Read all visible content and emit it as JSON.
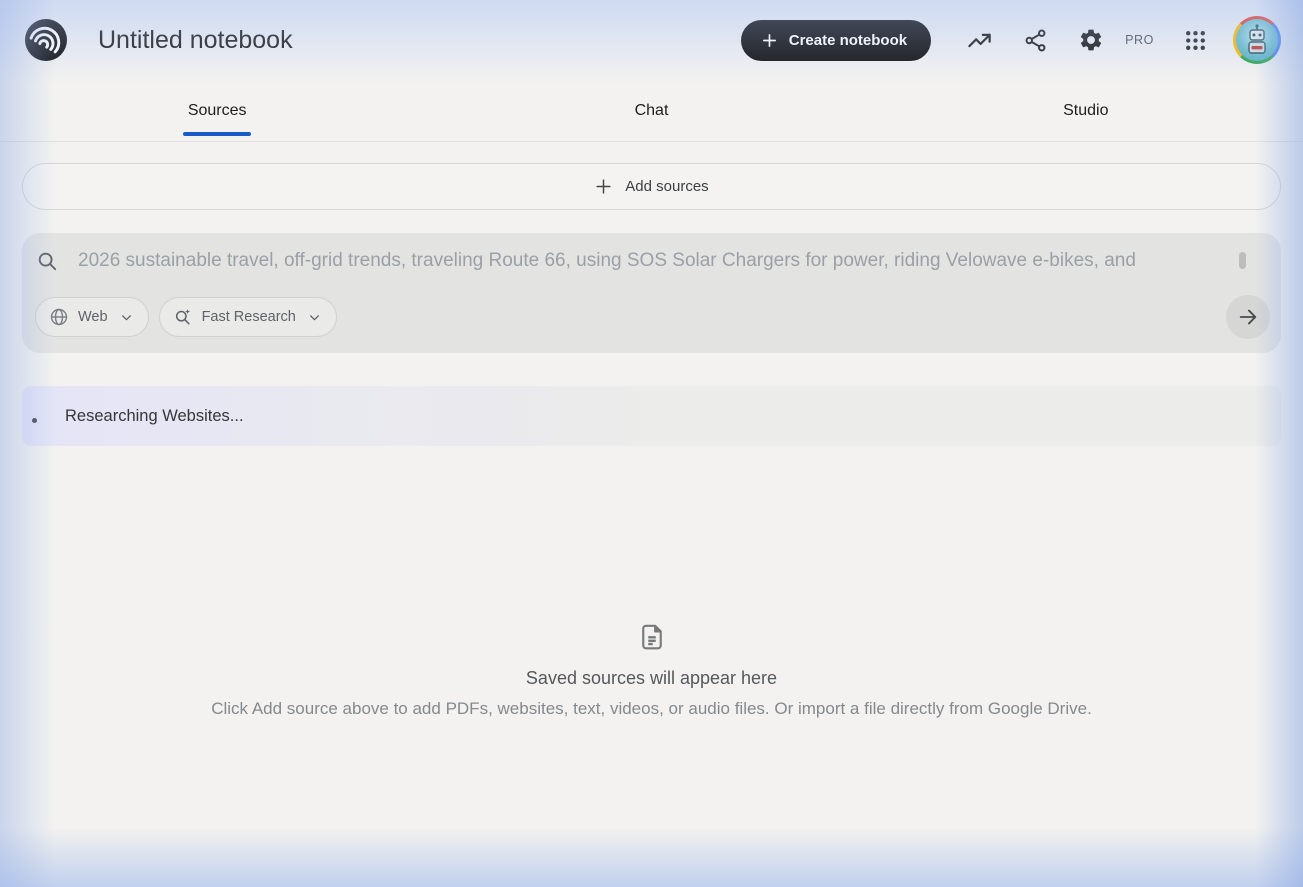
{
  "header": {
    "title": "Untitled notebook",
    "create_button_label": "Create notebook",
    "plan_badge": "PRO",
    "icons": {
      "logo": "notebooklm-waves-icon",
      "trending": "trending-up-icon",
      "share": "share-nodes-icon",
      "settings": "gear-icon",
      "apps": "grid-3x3-icon",
      "avatar": "robot-avatar"
    }
  },
  "tabs": [
    {
      "label": "Sources",
      "active": true
    },
    {
      "label": "Chat",
      "active": false
    },
    {
      "label": "Studio",
      "active": false
    }
  ],
  "sources_panel": {
    "add_button_label": "Add sources",
    "search": {
      "value": "2026 sustainable travel, off-grid trends, traveling Route 66, using SOS Solar Chargers for power, riding Velowave e-bikes, and",
      "source_chip_label": "Web",
      "mode_chip_label": "Fast Research",
      "icons": {
        "search": "magnifier-icon",
        "web": "globe-icon",
        "mode": "magnifier-sparkle-icon",
        "chevron": "chevron-down-icon",
        "submit": "arrow-right-icon"
      }
    },
    "status": {
      "message": "Researching Websites..."
    },
    "empty_state": {
      "icon": "document-lines-icon",
      "title": "Saved sources will appear here",
      "description": "Click Add source above to add PDFs, websites, text, videos, or audio files. Or import a file directly from Google Drive."
    }
  },
  "colors": {
    "accent_blue": "#1b5bc8",
    "button_black": "#131314",
    "panel_gray": "#e3e3e2",
    "status_lavender": "#e4e4f8",
    "ring_red": "#ea4335",
    "ring_blue": "#4285f4",
    "ring_green": "#34a853",
    "ring_yellow": "#fbbc05"
  }
}
